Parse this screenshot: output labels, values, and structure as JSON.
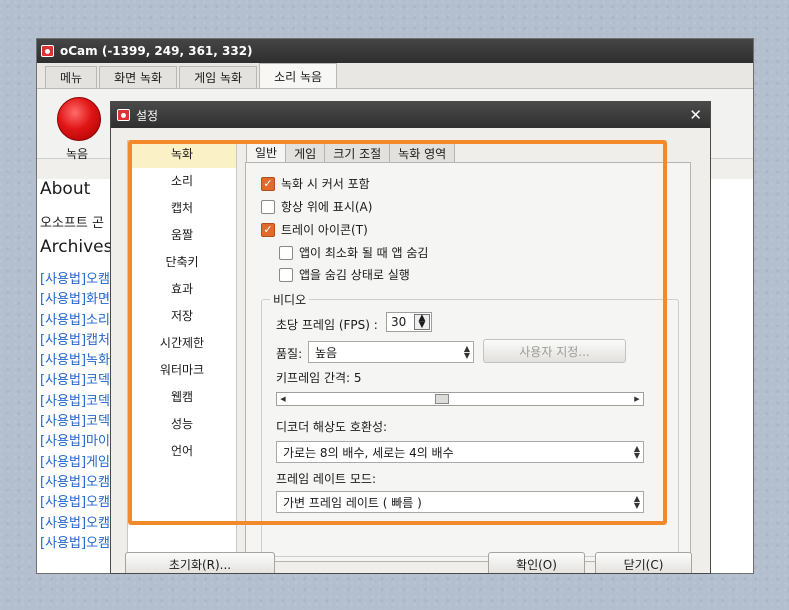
{
  "ocam": {
    "title": "oCam (-1399, 249, 361, 332)",
    "tabs": [
      "메뉴",
      "화면 녹화",
      "게임 녹화",
      "소리 녹음"
    ],
    "record_label": "녹음",
    "blog": {
      "about": "About",
      "subtitle": "오소프트 곤",
      "archives": "Archives",
      "links": [
        "[사용법]오캠",
        "[사용법]화면",
        "[사용법]소리",
        "[사용법]캡처",
        "[사용법]녹화",
        "[사용법]코덱",
        "[사용법]코덱",
        "[사용법]코덱",
        "[사용법]마이",
        "[사용법]게임",
        "[사용법]오캠",
        "[사용법]오캠",
        "[사용법]오캠",
        "[사용법]오캠"
      ]
    }
  },
  "dialog": {
    "title": "설정",
    "sidebar": [
      "녹화",
      "소리",
      "캡처",
      "움짤",
      "단축키",
      "효과",
      "저장",
      "시간제한",
      "워터마크",
      "웹캠",
      "성능",
      "언어"
    ],
    "tabs": [
      "일반",
      "게임",
      "크기 조절",
      "녹화 영역"
    ],
    "checks": {
      "cursor": "녹화 시 커서 포함",
      "always_top": "항상 위에 표시(A)",
      "tray_icon": "트레이 아이콘(T)",
      "hide_minimized": "앱이 최소화 될 때 앱 숨김",
      "run_hidden": "앱을 숨김 상태로 실행"
    },
    "video": {
      "group_title": "비디오",
      "fps_label": "초당 프레임 (FPS) :",
      "fps_value": "30",
      "quality_label": "품질:",
      "quality_value": "높음",
      "custom_button": "사용자 지정...",
      "keyframe_label": "키프레임 간격: 5",
      "decoder_label": "디코더 해상도 호환성:",
      "decoder_value": "가로는 8의 배수, 세로는 4의 배수",
      "framerate_label": "프레임 레이트 모드:",
      "framerate_value": "가변 프레임 레이트 ( 빠름 )"
    },
    "buttons": {
      "reset": "초기화(R)...",
      "ok": "확인(O)",
      "close": "닫기(C)"
    }
  },
  "colors": {
    "highlight": "#f28a2b",
    "checkbox_on": "#e06b2d",
    "link": "#2266cc"
  }
}
